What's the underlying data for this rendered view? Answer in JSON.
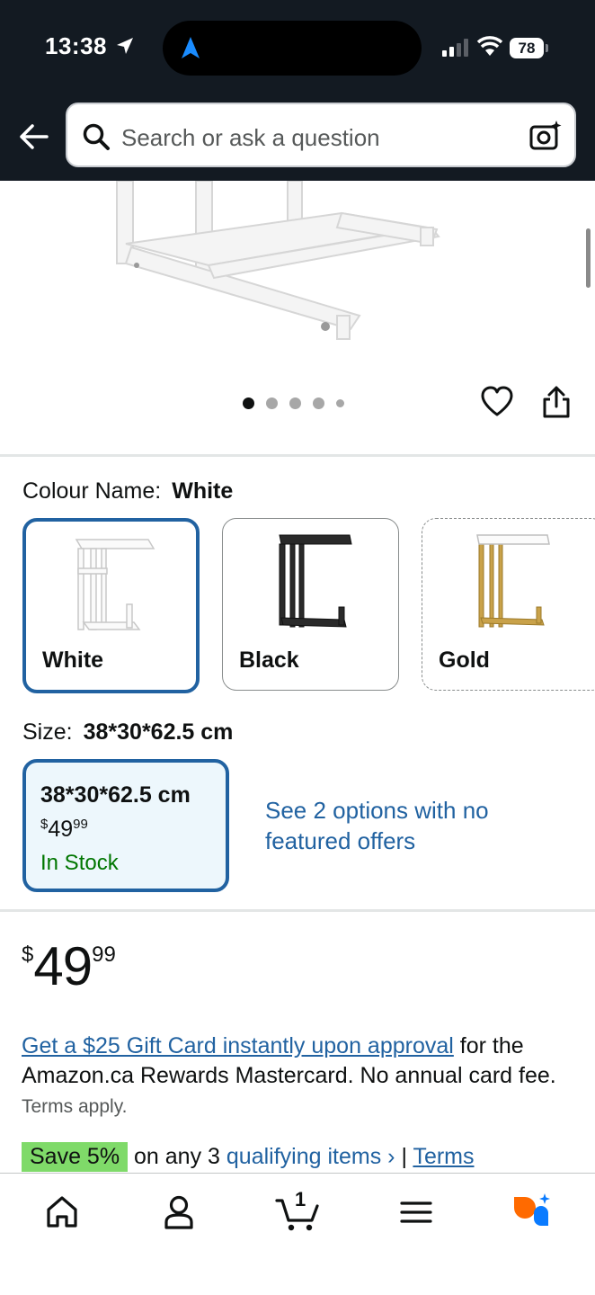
{
  "status_bar": {
    "time": "13:38",
    "battery": "78"
  },
  "search": {
    "placeholder": "Search or ask a question"
  },
  "carousel": {
    "page_count": 5,
    "active_index": 0
  },
  "colour": {
    "label": "Colour Name:",
    "selected": "White",
    "options": [
      {
        "name": "White",
        "selected": true,
        "available": true
      },
      {
        "name": "Black",
        "selected": false,
        "available": true
      },
      {
        "name": "Gold",
        "selected": false,
        "available": false
      }
    ]
  },
  "size": {
    "label": "Size:",
    "selected": "38*30*62.5 cm",
    "option": {
      "title": "38*30*62.5 cm",
      "price_currency": "$",
      "price_whole": "49",
      "price_fraction": "99",
      "stock": "In Stock"
    },
    "see_options_link": "See 2 options with no featured offers"
  },
  "price": {
    "currency": "$",
    "whole": "49",
    "fraction": "99"
  },
  "promo": {
    "link_text": "Get a $25 Gift Card instantly upon approval",
    "body": " for the Amazon.ca Rewards Mastercard. No annual card fee.",
    "terms": "Terms apply."
  },
  "save": {
    "badge": "Save 5%",
    "text": "on any 3",
    "link": "qualifying items",
    "chevron": "›",
    "separator": "|",
    "terms": "Terms"
  },
  "tabbar": {
    "items": [
      {
        "icon": "home-icon"
      },
      {
        "icon": "account-icon"
      },
      {
        "icon": "cart-icon",
        "badge": "1"
      },
      {
        "icon": "menu-icon"
      },
      {
        "icon": "rufus-assistant-icon"
      }
    ]
  },
  "colors": {
    "header_bg": "#131a22",
    "link": "#2162a1",
    "selected_border": "#2162a1",
    "in_stock": "#007600",
    "save_badge": "#7fda69",
    "assistant_orange": "#ff6a00",
    "assistant_blue": "#0a7bff"
  }
}
